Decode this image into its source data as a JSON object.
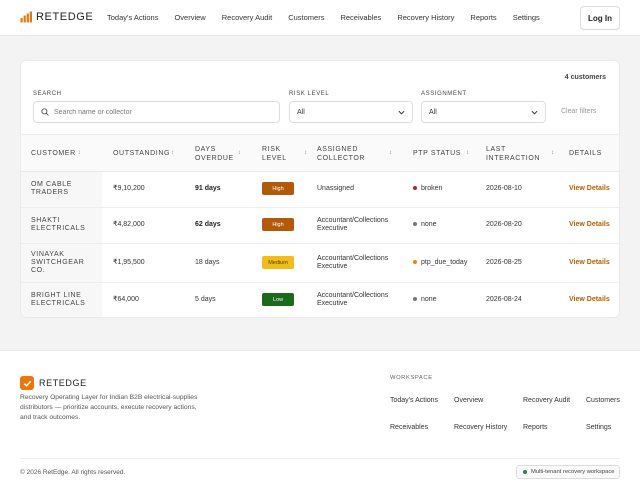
{
  "header": {
    "brand": "RETEDGE",
    "nav": [
      "Today's Actions",
      "Overview",
      "Recovery Audit",
      "Customers",
      "Receivables",
      "Recovery History",
      "Reports",
      "Settings"
    ],
    "login_label": "Log In"
  },
  "toolbar": {
    "count": "4 customers",
    "search_label": "SEARCH",
    "search_placeholder": "Search name or collector",
    "risk_label": "RISK LEVEL",
    "risk_value": "All",
    "assign_label": "ASSIGNMENT",
    "assign_value": "All",
    "clear_label": "Clear filters"
  },
  "table": {
    "headers": {
      "customer": "CUSTOMER",
      "outstanding": "OUTSTANDING",
      "days_overdue_1": "DAYS",
      "days_overdue_2": "OVERDUE",
      "risk_1": "RISK",
      "risk_2": "LEVEL",
      "collector_1": "ASSIGNED",
      "collector_2": "COLLECTOR",
      "ptp": "PTP STATUS",
      "last_1": "LAST",
      "last_2": "INTERACTION",
      "details": "DETAILS"
    },
    "sort_glyph": "↕",
    "rows": [
      {
        "name": [
          "OM CABLE",
          "TRADERS"
        ],
        "outstanding": "₹9,10,200",
        "days": "91 days",
        "days_bold": true,
        "risk": "High",
        "risk_bg": "#b35a09",
        "risk_fg": "#ffffff",
        "collector": [
          "Unassigned"
        ],
        "ptp": "broken",
        "ptp_color": "#a52a2a",
        "last": "2026-08-10",
        "action": "View Details"
      },
      {
        "name": [
          "SHAKTI",
          "ELECTRICALS"
        ],
        "outstanding": "₹4,82,000",
        "days": "62 days",
        "days_bold": true,
        "risk": "High",
        "risk_bg": "#b35a09",
        "risk_fg": "#ffffff",
        "collector": [
          "Accountant/Collections",
          "Executive"
        ],
        "ptp": "none",
        "ptp_color": "#777777",
        "last": "2026-08-20",
        "action": "View Details"
      },
      {
        "name": [
          "VINAYAK",
          "SWITCHGEAR",
          "CO."
        ],
        "outstanding": "₹1,95,500",
        "days": "18 days",
        "days_bold": false,
        "risk": "Medium",
        "risk_bg": "#f0bd1c",
        "risk_fg": "#5a3d00",
        "collector": [
          "Accountant/Collections",
          "Executive"
        ],
        "ptp": "ptp_due_today",
        "ptp_color": "#e8880c",
        "last": "2026-08-25",
        "action": "View Details"
      },
      {
        "name": [
          "BRIGHT LINE",
          "ELECTRICALS"
        ],
        "outstanding": "₹64,000",
        "days": "5 days",
        "days_bold": false,
        "risk": "Low",
        "risk_bg": "#1b6a1b",
        "risk_fg": "#ffffff",
        "collector": [
          "Accountant/Collections",
          "Executive"
        ],
        "ptp": "none",
        "ptp_color": "#777777",
        "last": "2026-08-24",
        "action": "View Details"
      }
    ]
  },
  "footer": {
    "brand": "RETEDGE",
    "description": "Recovery Operating Layer for Indian B2B electrical-supplies distributors — prioritize accounts, execute recovery actions, and track outcomes.",
    "workspace_label": "WORKSPACE",
    "links": [
      "Today's Actions",
      "Overview",
      "Recovery Audit",
      "Customers",
      "Receivables",
      "Recovery History",
      "Reports",
      "Settings"
    ],
    "copyright": "© 2026 RetEdge. All rights reserved.",
    "badge": "Multi-tenant recovery workspace",
    "badge_dot_color": "#1b8a3a"
  },
  "colors": {
    "accent": "#e8780c",
    "link": "#b35f00"
  },
  "icons": {
    "brand": "bar-chart-icon",
    "search": "search-icon",
    "select": "chevron-down-icon",
    "sort": "sort-icon",
    "footer_logo": "check-icon"
  }
}
